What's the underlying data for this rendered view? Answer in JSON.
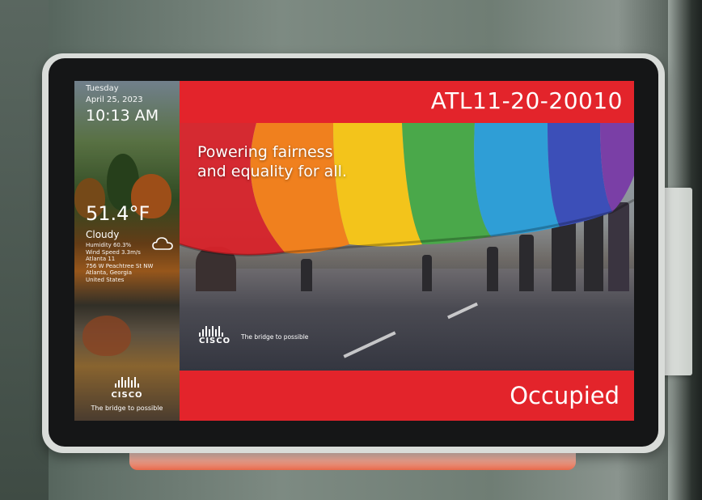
{
  "left_panel": {
    "weekday": "Tuesday",
    "date": "April 25, 2023",
    "time": "10:13 AM",
    "temperature": "51.4°F",
    "condition": "Cloudy",
    "details": [
      "Humidity 60.3%",
      "Wind Speed 3.3m/s",
      "Atlanta 11",
      "756 W Peachtree St NW",
      "Atlanta, Georgia",
      "United States"
    ],
    "weather_icon": "cloud-icon",
    "logo_text": "CISCO",
    "tagline": "The bridge to possible"
  },
  "header": {
    "room_name": "ATL11-20-20010",
    "bar_color": "#e3242b"
  },
  "photo": {
    "headline_line1": "Powering fairness",
    "headline_line2": "and equality for all.",
    "logo_text": "CISCO",
    "tagline": "The bridge to possible"
  },
  "footer": {
    "status": "Occupied",
    "bar_color": "#e3242b"
  }
}
